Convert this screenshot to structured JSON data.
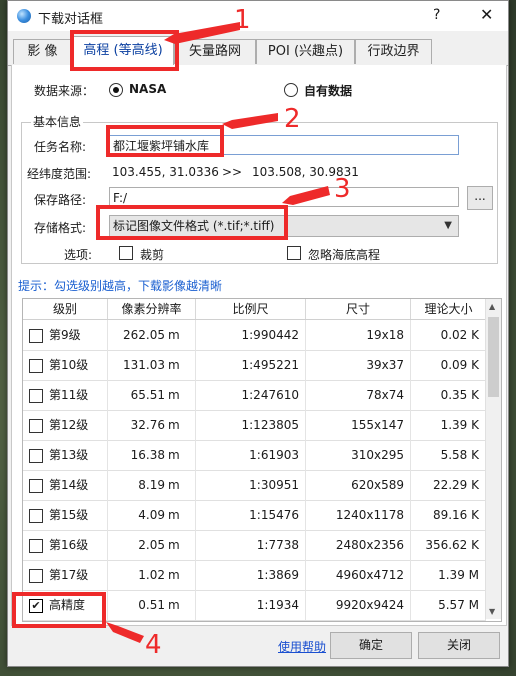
{
  "window": {
    "title": "下载对话框",
    "help": "?",
    "close": "✕"
  },
  "tabs": [
    {
      "label": "影  像"
    },
    {
      "label": "高程 (等高线)"
    },
    {
      "label": "矢量路网"
    },
    {
      "label": "POI (兴趣点)"
    },
    {
      "label": "行政边界"
    }
  ],
  "source": {
    "label": "数据来源：",
    "option1": "NASA",
    "option2": "自有数据",
    "selected": "NASA"
  },
  "basic_info": {
    "title": "基本信息",
    "task_label": "任务名称:",
    "task_value": "都江堰紫坪铺水库",
    "range_label": "经纬度范围:",
    "range_start": "103.455, 31.0336",
    "range_sep": ">>",
    "range_end": "103.508, 30.9831",
    "path_label": "保存路径:",
    "path_value": "F:/",
    "browse": "...",
    "format_label": "存储格式:",
    "format_value": "标记图像文件格式 (*.tif;*.tiff)",
    "options_label": "选项:",
    "crop_label": "裁剪",
    "ignore_label": "忽略海底高程"
  },
  "hint": "提示：勾选级别越高，下载影像越清晰",
  "table": {
    "headers": [
      "级别",
      "像素分辨率",
      "比例尺",
      "尺寸",
      "理论大小"
    ],
    "rows": [
      {
        "level": "第9级",
        "res": "262.05",
        "unit": "m",
        "scale": "1:990442",
        "size": "19x18",
        "theory": "0.02 K",
        "checked": false
      },
      {
        "level": "第10级",
        "res": "131.03",
        "unit": "m",
        "scale": "1:495221",
        "size": "39x37",
        "theory": "0.09 K",
        "checked": false
      },
      {
        "level": "第11级",
        "res": "65.51",
        "unit": "m",
        "scale": "1:247610",
        "size": "78x74",
        "theory": "0.35 K",
        "checked": false
      },
      {
        "level": "第12级",
        "res": "32.76",
        "unit": "m",
        "scale": "1:123805",
        "size": "155x147",
        "theory": "1.39 K",
        "checked": false
      },
      {
        "level": "第13级",
        "res": "16.38",
        "unit": "m",
        "scale": "1:61903",
        "size": "310x295",
        "theory": "5.58 K",
        "checked": false
      },
      {
        "level": "第14级",
        "res": "8.19",
        "unit": "m",
        "scale": "1:30951",
        "size": "620x589",
        "theory": "22.29 K",
        "checked": false
      },
      {
        "level": "第15级",
        "res": "4.09",
        "unit": "m",
        "scale": "1:15476",
        "size": "1240x1178",
        "theory": "89.16 K",
        "checked": false
      },
      {
        "level": "第16级",
        "res": "2.05",
        "unit": "m",
        "scale": "1:7738",
        "size": "2480x2356",
        "theory": "356.62 K",
        "checked": false
      },
      {
        "level": "第17级",
        "res": "1.02",
        "unit": "m",
        "scale": "1:3869",
        "size": "4960x4712",
        "theory": "1.39 M",
        "checked": false
      },
      {
        "level": "高精度",
        "res": "0.51",
        "unit": "m",
        "scale": "1:1934",
        "size": "9920x9424",
        "theory": "5.57 M",
        "checked": true
      }
    ]
  },
  "footer": {
    "help_link": "使用帮助",
    "ok": "确定",
    "close": "关闭"
  },
  "annotations": {
    "n1": "1",
    "n2": "2",
    "n3": "3",
    "n4": "4",
    "color": "#ee2a2a"
  }
}
